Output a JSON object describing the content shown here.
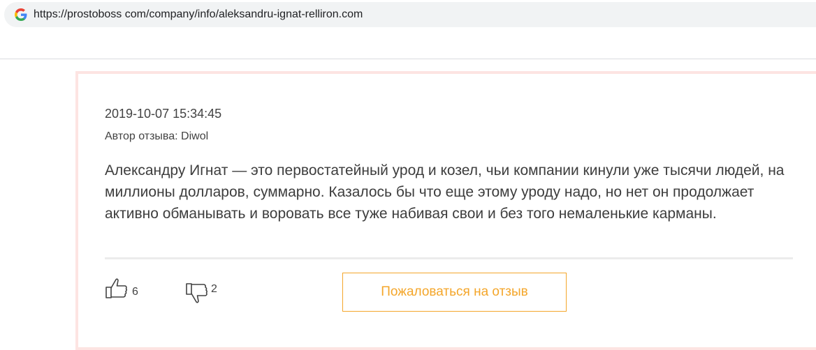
{
  "browser": {
    "url": "https://prostoboss com/company/info/aleksandru-ignat-relliron.com",
    "favicon": "google-g-icon"
  },
  "review": {
    "date": "2019-10-07 15:34:45",
    "author_label": "Автор отзыва: Diwol",
    "text": "Александру Игнат — это первостатейный урод и козел, чьи компании кинули уже тысячи людей, на миллионы долларов, суммарно. Казалось бы что еще этому уроду надо, но нет он продолжает активно обманывать и воровать все туже набивая свои и без того немаленькие карманы.",
    "likes": "6",
    "dislikes": "2",
    "like_icon": "thumbs-up-icon",
    "dislike_icon": "thumbs-down-icon",
    "complain_label": "Пожаловаться на отзыв"
  },
  "colors": {
    "accent": "#f4a62a",
    "card_border": "#fde4e2",
    "url_bar_bg": "#f1f3f4"
  }
}
